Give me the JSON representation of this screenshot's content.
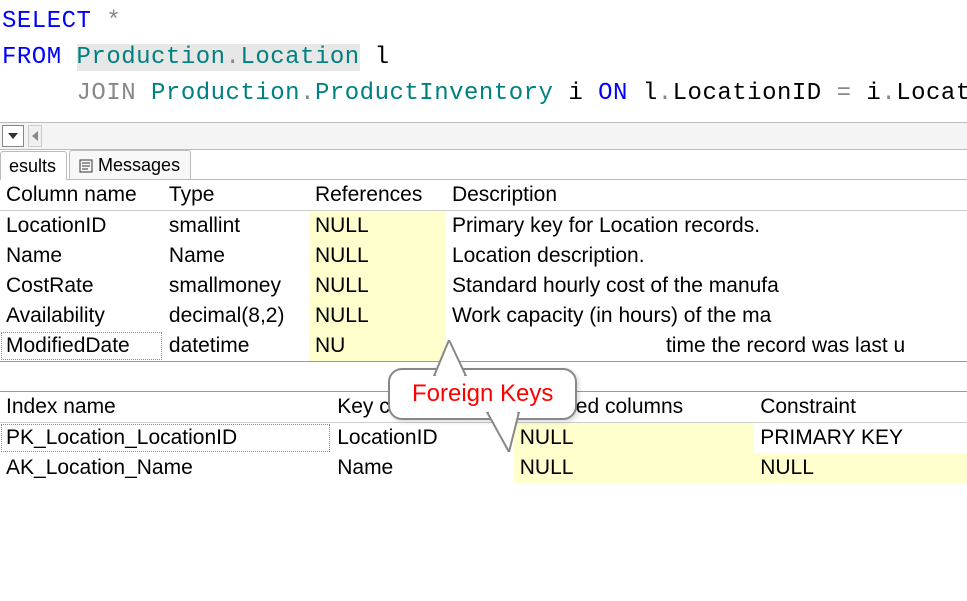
{
  "sql": {
    "line1": {
      "select": "SELECT",
      "star": "*"
    },
    "line2": {
      "from": "FROM",
      "schema": "Production",
      "dot": ".",
      "table": "Location",
      "alias": "l"
    },
    "line3": {
      "indent": "     ",
      "join": "JOIN",
      "schema": "Production",
      "dot": ".",
      "table": "ProductInventory",
      "alias": "i",
      "on": "ON",
      "lhs_alias": "l",
      "lhs_col": "LocationID",
      "eq": "=",
      "rhs_alias": "i",
      "rhs_col": "LocationID"
    }
  },
  "tabs": {
    "results": "esults",
    "messages": "Messages"
  },
  "table1": {
    "headers": [
      "Column name",
      "Type",
      "References",
      "Description"
    ],
    "rows": [
      {
        "col": "LocationID",
        "type": "smallint",
        "ref": "NULL",
        "desc": "Primary key for Location records."
      },
      {
        "col": "Name",
        "type": "Name",
        "ref": "NULL",
        "desc": "Location description."
      },
      {
        "col": "CostRate",
        "type": "smallmoney",
        "ref": "NULL",
        "desc": "Standard hourly cost of the manufa"
      },
      {
        "col": "Availability",
        "type": "decimal(8,2)",
        "ref": "NULL",
        "desc": "Work capacity (in hours) of the ma"
      },
      {
        "col": "ModifiedDate",
        "type": "datetime",
        "ref": "NU",
        "desc": "time the record was last u"
      }
    ]
  },
  "table2": {
    "headers": [
      "Index name",
      "Key columns",
      "Included columns",
      "Constraint"
    ],
    "rows": [
      {
        "idx": "PK_Location_LocationID",
        "key": "LocationID",
        "inc": "NULL",
        "con": "PRIMARY KEY"
      },
      {
        "idx": "AK_Location_Name",
        "key": "Name",
        "inc": "NULL",
        "con": "NULL"
      }
    ]
  },
  "callout": {
    "label": "Foreign Keys"
  }
}
